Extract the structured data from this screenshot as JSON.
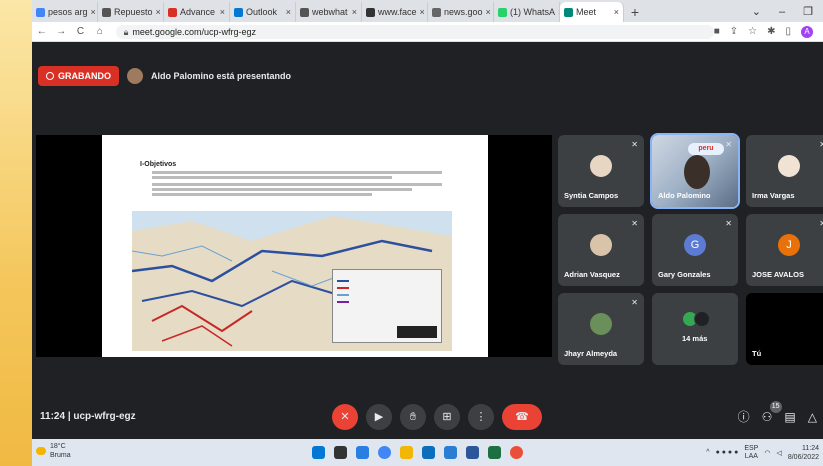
{
  "browser": {
    "tabs": [
      {
        "label": "pesos arg",
        "color": "#4285f4"
      },
      {
        "label": "Repuesto",
        "color": "#555555"
      },
      {
        "label": "Advance",
        "color": "#d93025"
      },
      {
        "label": "Outlook",
        "color": "#0078d4"
      },
      {
        "label": "webwhat",
        "color": "#555555"
      },
      {
        "label": "www.face",
        "color": "#333333"
      },
      {
        "label": "news.goo",
        "color": "#666666"
      },
      {
        "label": "(1) WhatsA",
        "color": "#25d366"
      },
      {
        "label": "Meet",
        "color": "#00897b",
        "active": true
      }
    ],
    "new_tab": "+",
    "url": "meet.google.com/ucp-wfrg-egz",
    "profile_initial": "A"
  },
  "meet": {
    "recording_label": "GRABANDO",
    "presenter_text": "Aldo Palomino está presentando",
    "meeting_time": "11:24",
    "meeting_code": "ucp-wfrg-egz",
    "participants_count": "15",
    "slide": {
      "title": "I-Objetivos"
    },
    "participants": [
      {
        "name": "Syntia Campos",
        "avatar_color": "#e8d6c4"
      },
      {
        "name": "Aldo Palomino",
        "video": true,
        "logo": "peru"
      },
      {
        "name": "Irma Vargas",
        "avatar_color": "#f1e3d3"
      },
      {
        "name": "Adrian Vasquez",
        "avatar_color": "#d9c3a9"
      },
      {
        "name": "Gary Gonzales",
        "initial": "G",
        "avatar_color": "#5b7bd5"
      },
      {
        "name": "JOSE AVALOS",
        "initial": "J",
        "avatar_color": "#e8710a"
      },
      {
        "name": "Jhayr Almeyda",
        "avatar_color": "#6b8f5a"
      },
      {
        "name": "14 más"
      },
      {
        "name": "Tú"
      }
    ]
  },
  "taskbar": {
    "temperature": "18°C",
    "weather": "Bruma",
    "lang_top": "ESP",
    "lang_bottom": "LAA",
    "time": "11:24",
    "date": "8/06/2022"
  }
}
